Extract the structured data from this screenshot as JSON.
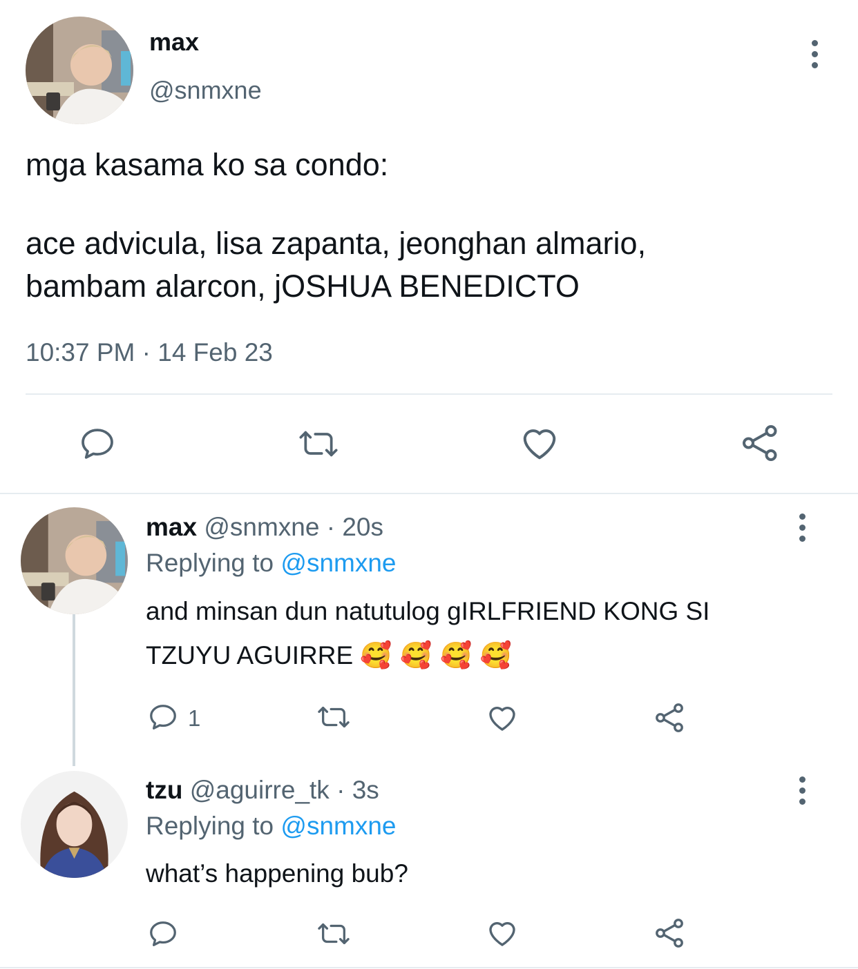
{
  "main_tweet": {
    "author_name": "max",
    "handle": "@snmxne",
    "text_line1": "mga kasama ko sa condo:",
    "text_line2": "ace advicula, lisa zapanta, jeonghan almario,",
    "text_line3": "bambam alarcon, jOSHUA BENEDICTO",
    "timestamp": "10:37 PM · 14 Feb 23"
  },
  "replies": [
    {
      "author_name": "max",
      "handle_time": "@snmxne · 20s",
      "replying_prefix": "Replying to",
      "replying_handle": "@snmxne",
      "text_line1": "and minsan dun natutulog gIRLFRIEND KONG SI",
      "text_line2": "TZUYU AGUIRRE",
      "emojis": "🥰 🥰 🥰 🥰",
      "reply_count": "1"
    },
    {
      "author_name": "tzu",
      "handle_time": "@aguirre_tk · 3s",
      "replying_prefix": "Replying to",
      "replying_handle": "@snmxne",
      "text_line1": "what’s happening bub?",
      "reply_count": ""
    }
  ],
  "icons": [
    "reply-icon",
    "retweet-icon",
    "like-icon",
    "share-icon",
    "more-icon"
  ],
  "colors": {
    "text": "#0f1419",
    "muted": "#536471",
    "link": "#1d9bf0",
    "divider": "#e6ecf0"
  }
}
